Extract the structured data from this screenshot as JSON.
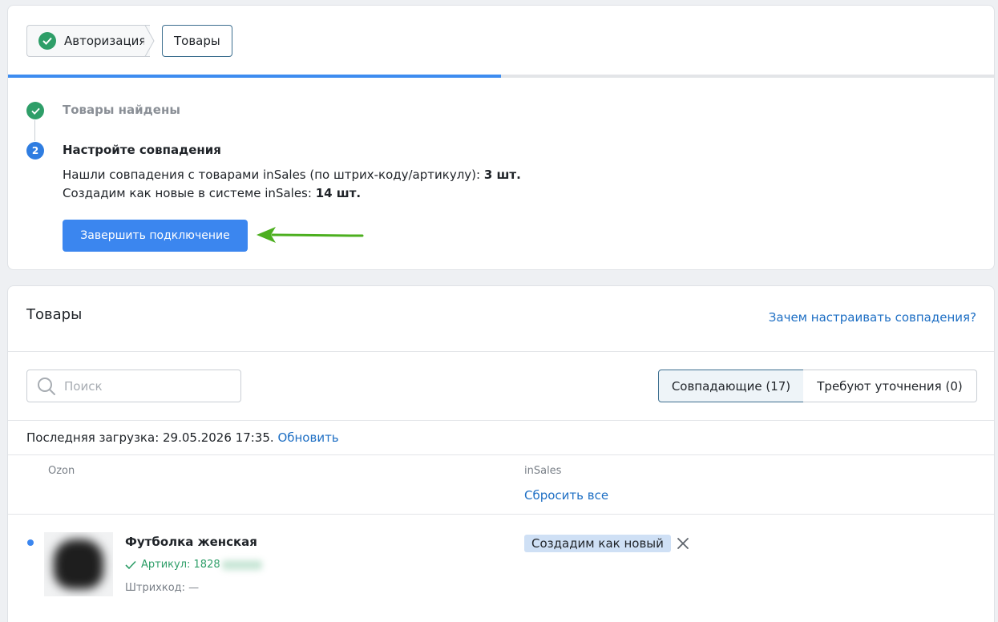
{
  "breadcrumb": {
    "step_auth": "Авторизация",
    "step_products": "Товары"
  },
  "progress": {
    "fraction": 0.5
  },
  "wizard": {
    "step1_label": "Товары найдены",
    "step2_number": "2",
    "step2_label": "Настройте совпадения",
    "matched_text": "Нашли совпадения с товарами inSales (по штрих-коду/артикулу): ",
    "matched_count": "3 шт.",
    "new_text": "Создадим как новые в системе inSales: ",
    "new_count": "14 шт.",
    "finish_button": "Завершить подключение"
  },
  "products": {
    "title": "Товары",
    "why_link": "Зачем настраивать совпадения?",
    "search_placeholder": "Поиск",
    "search_value": "",
    "tab_matching": "Совпадающие (17)",
    "tab_clarify": "Требуют уточнения (0)",
    "last_load_text": "Последняя загрузка: 29.05.2026 17:35. ",
    "refresh_link": "Обновить",
    "col_ozon": "Ozon",
    "col_insales": "inSales",
    "reset_all": "Сбросить все",
    "rows": [
      {
        "name": "Футболка женская",
        "sku_label": "Артикул: 1828",
        "barcode_label": "Штрихкод: —",
        "insales_badge": "Создадим как новый"
      }
    ]
  },
  "colors": {
    "primary_button": "#3b86ef",
    "success": "#2e9e68",
    "link": "#1e6fc4",
    "arrow": "#4caf1f"
  }
}
